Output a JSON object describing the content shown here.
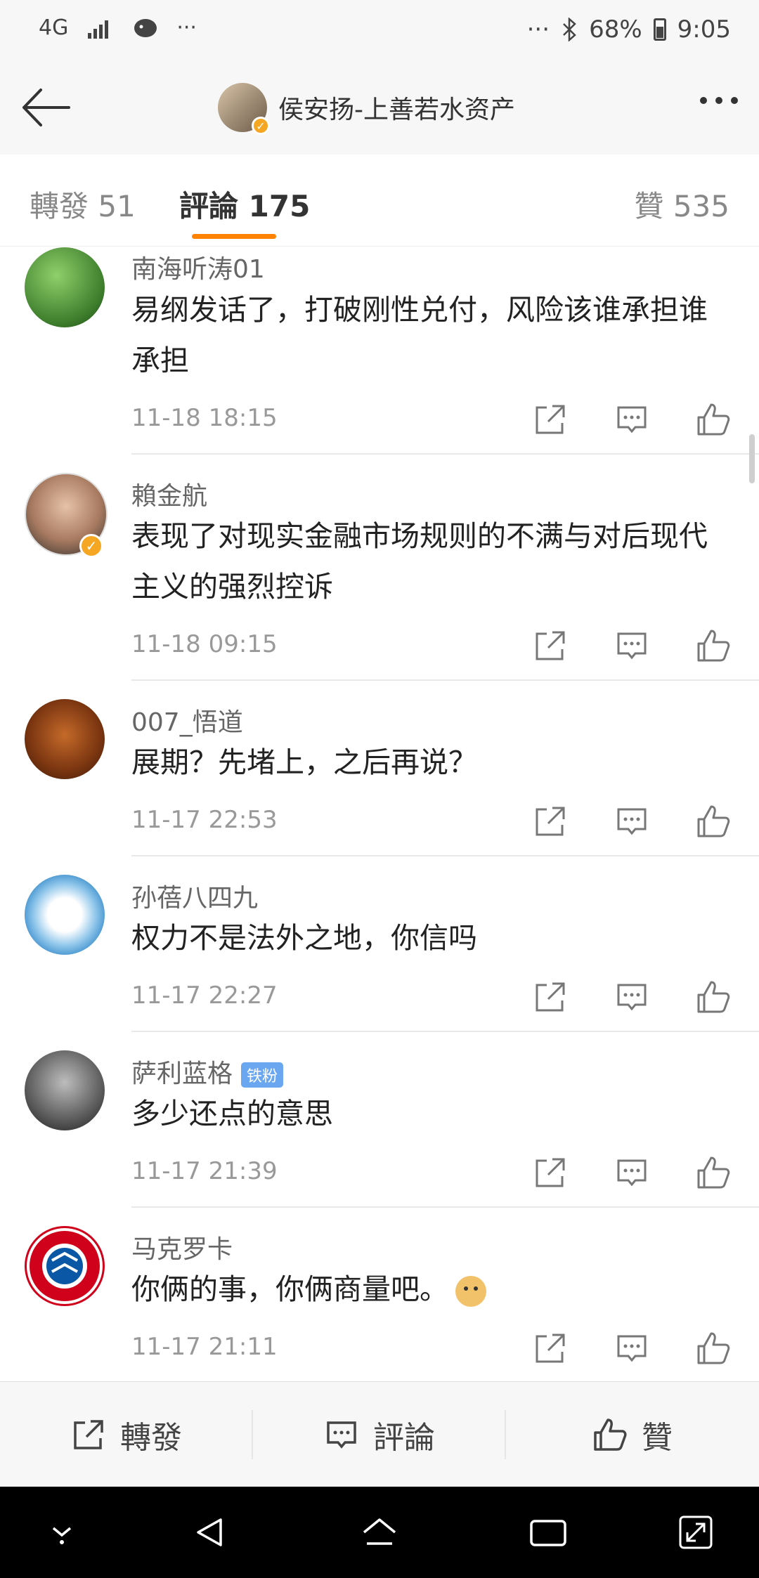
{
  "status_bar": {
    "network": "4G",
    "more_left": "···",
    "more_right": "···",
    "battery": "68%",
    "time": "9:05",
    "icons": [
      "signal-icon",
      "app-notification-icon",
      "bluetooth-icon",
      "battery-icon"
    ]
  },
  "header": {
    "title": "侯安扬-上善若水资产",
    "back_icon": "back-arrow-icon",
    "more_icon": "more-dots-icon"
  },
  "tabs": {
    "repost": "轉發 51",
    "comments": "評論 175",
    "likes": "贊 535"
  },
  "comments": [
    {
      "name": "南海听涛01",
      "text": "易纲发话了，打破刚性兑付，风险该谁承担谁承担",
      "time": "11-18 18:15"
    },
    {
      "name": "賴金航",
      "text": "表现了对现实金融市场规则的不满与对后现代主义的强烈控诉",
      "time": "11-18 09:15"
    },
    {
      "name": "007_悟道",
      "text": "展期？先堵上，之后再说？",
      "time": "11-17 22:53"
    },
    {
      "name": "孙蓓八四九",
      "text": "权力不是法外之地，你信吗",
      "time": "11-17 22:27"
    },
    {
      "name": "萨利蓝格",
      "badge": "铁粉",
      "text": "多少还点的意思",
      "time": "11-17 21:39"
    },
    {
      "name": "马克罗卡",
      "text": "你俩的事，你俩商量吧。",
      "time": "11-17 21:11"
    }
  ],
  "toolbar": {
    "repost": "轉發",
    "comment": "評論",
    "like": "贊"
  },
  "colors": {
    "accent": "#ff8200",
    "header_bg": "#f7f7f7",
    "verified": "#f5a623",
    "fan_badge": "#6aa7f0"
  }
}
